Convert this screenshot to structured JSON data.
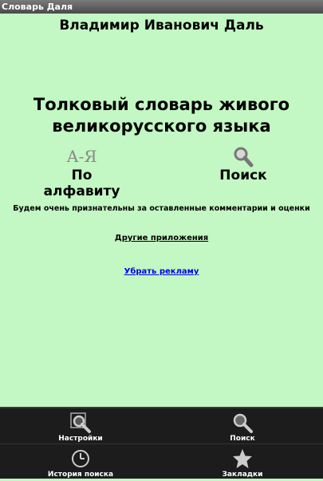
{
  "window": {
    "title": "Словарь Даля"
  },
  "header": {
    "author": "Владимир Иванович Даль"
  },
  "dictionary": {
    "title_line1": "Толковый словарь живого",
    "title_line2": "великорусского языка"
  },
  "nav": {
    "alphabet": {
      "icon_text": "А-Я",
      "label": "По алфавиту"
    },
    "search": {
      "label": "Поиск"
    }
  },
  "messages": {
    "thanks": "Будем очень признательны за оставленные комментарии и оценки",
    "other_apps": "Другие приложения",
    "remove_ads": "Убрать рекламу"
  },
  "menu": {
    "items": [
      {
        "label": "Настройки",
        "icon": "settings-magnifier-icon"
      },
      {
        "label": "Поиск",
        "icon": "search-icon"
      },
      {
        "label": "История поиска",
        "icon": "clock-icon"
      },
      {
        "label": "Закладки",
        "icon": "star-icon"
      }
    ]
  },
  "colors": {
    "background": "#c3f7c3",
    "link": "#0000ee",
    "menu_bg": "#1c1c1c"
  }
}
